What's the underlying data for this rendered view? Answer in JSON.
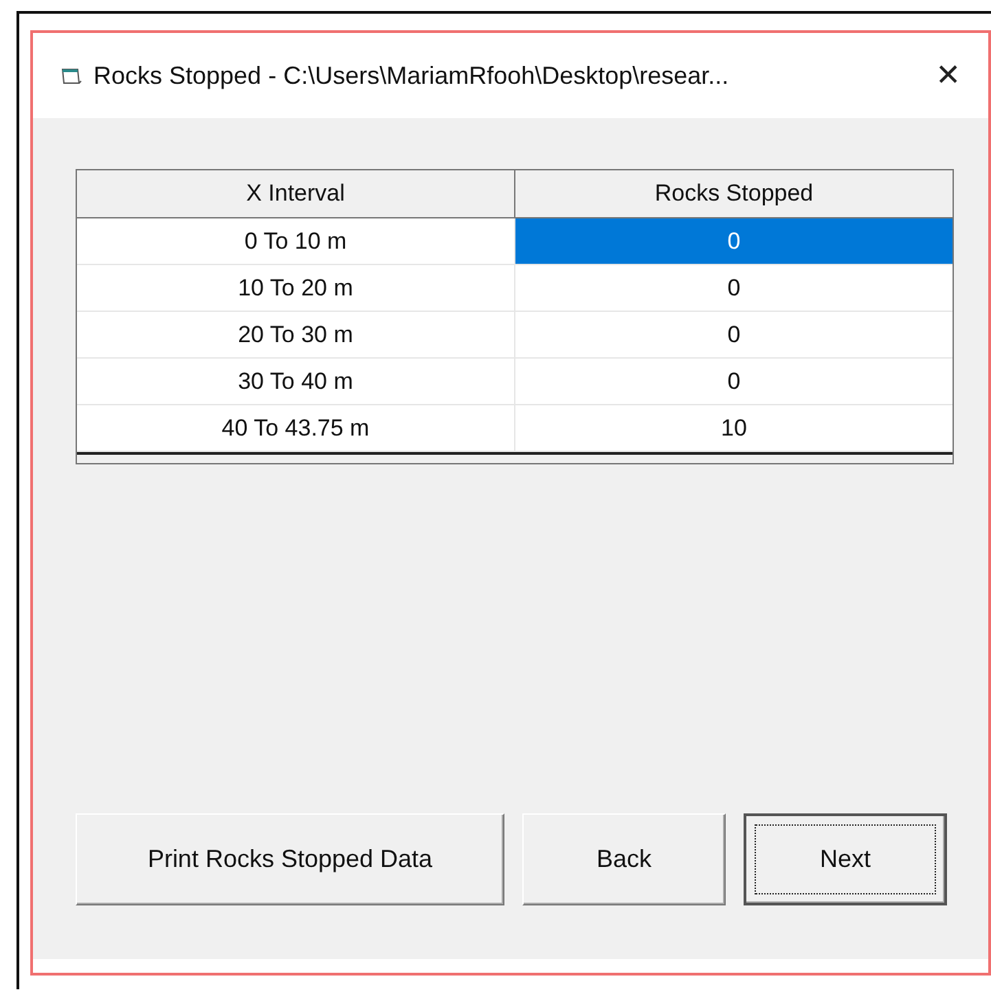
{
  "window": {
    "title": "Rocks Stopped  -  C:\\Users\\MariamRfooh\\Desktop\\resear...",
    "close": "✕"
  },
  "table": {
    "columns": [
      "X Interval",
      "Rocks Stopped"
    ],
    "rows": [
      {
        "interval": "0 To  10 m",
        "rocks": "0",
        "selected": true
      },
      {
        "interval": "10 To  20 m",
        "rocks": "0",
        "selected": false
      },
      {
        "interval": "20 To  30 m",
        "rocks": "0",
        "selected": false
      },
      {
        "interval": "30 To  40 m",
        "rocks": "0",
        "selected": false
      },
      {
        "interval": "40 To  43.75 m",
        "rocks": "10",
        "selected": false
      }
    ]
  },
  "buttons": [
    {
      "label": "Print Rocks Stopped Data",
      "focused": false
    },
    {
      "label": "Back",
      "focused": false
    },
    {
      "label": "Next",
      "focused": true
    }
  ]
}
